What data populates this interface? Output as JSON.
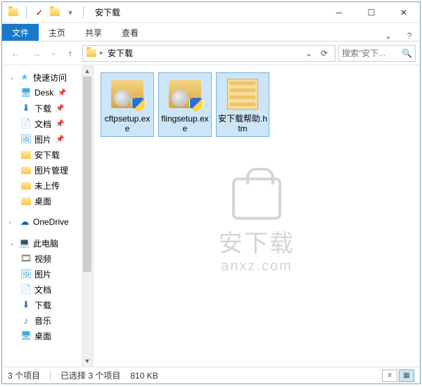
{
  "titlebar": {
    "title": "安下载"
  },
  "ribbon": {
    "file": "文件",
    "tabs": [
      "主页",
      "共享",
      "查看"
    ]
  },
  "address": {
    "crumbs": [
      "安下载"
    ]
  },
  "search": {
    "placeholder": "搜索\"安下..."
  },
  "sidebar": {
    "quick_access": "快速访问",
    "items": [
      {
        "label": "Desk",
        "icon": "desktop",
        "pinned": true
      },
      {
        "label": "下载",
        "icon": "download",
        "pinned": true
      },
      {
        "label": "文档",
        "icon": "doc",
        "pinned": true
      },
      {
        "label": "图片",
        "icon": "pic",
        "pinned": true
      },
      {
        "label": "安下载",
        "icon": "folder",
        "pinned": false
      },
      {
        "label": "图片管理",
        "icon": "folder",
        "pinned": false
      },
      {
        "label": "未上传",
        "icon": "folder",
        "pinned": false
      },
      {
        "label": "桌面",
        "icon": "folder",
        "pinned": false
      }
    ],
    "onedrive": "OneDrive",
    "this_pc": "此电脑",
    "pc_items": [
      {
        "label": "视频",
        "icon": "video"
      },
      {
        "label": "图片",
        "icon": "pic"
      },
      {
        "label": "文档",
        "icon": "doc"
      },
      {
        "label": "下载",
        "icon": "download"
      },
      {
        "label": "音乐",
        "icon": "music"
      },
      {
        "label": "桌面",
        "icon": "desktop"
      }
    ]
  },
  "files": [
    {
      "name": "cftpsetup.exe",
      "type": "exe"
    },
    {
      "name": "flingsetup.exe",
      "type": "exe"
    },
    {
      "name": "安下载帮助.htm",
      "type": "htm"
    }
  ],
  "watermark": {
    "line1": "安下载",
    "line2": "anxz.com"
  },
  "status": {
    "count": "3 个项目",
    "selection": "已选择 3 个项目",
    "size": "810 KB"
  }
}
